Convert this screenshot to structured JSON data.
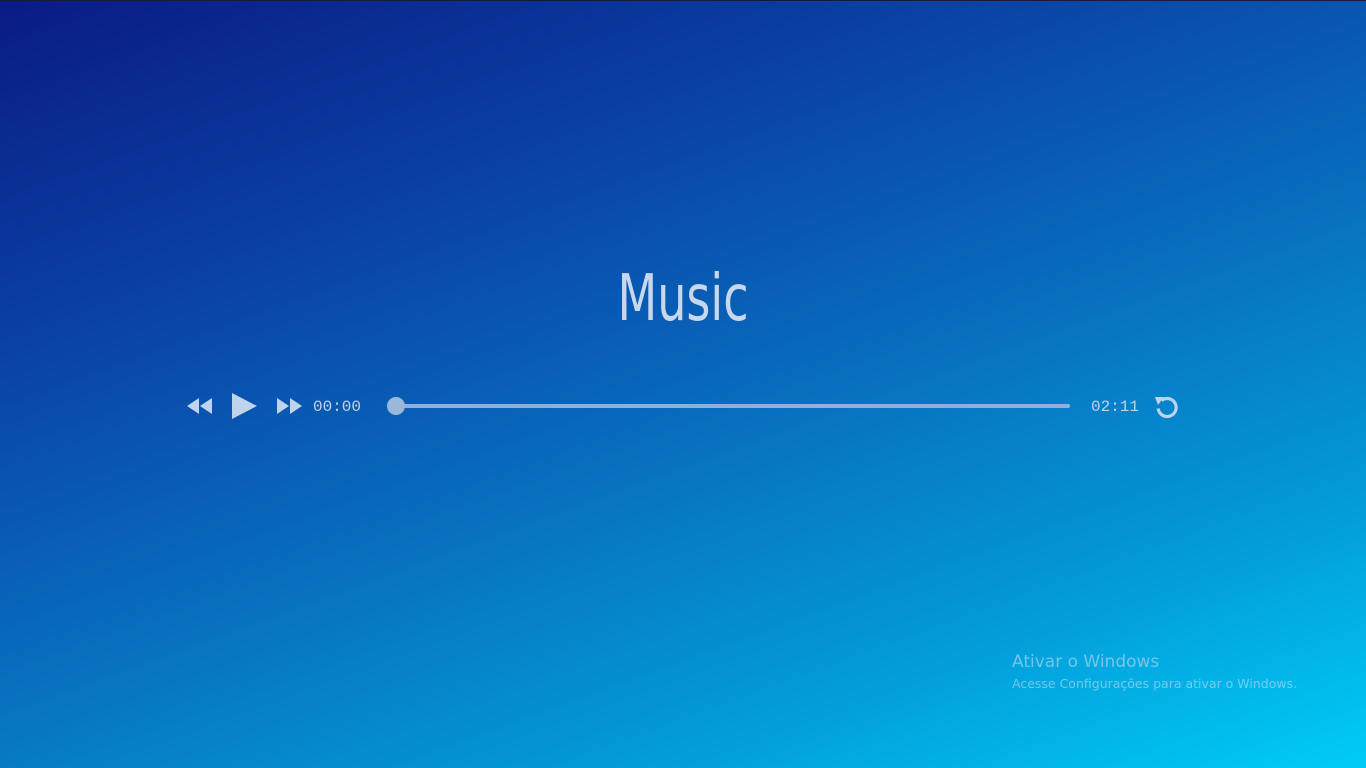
{
  "title": "Music",
  "player": {
    "current_time": "00:00",
    "duration": "02:11",
    "progress": 0,
    "icons": {
      "rewind": "rewind-icon",
      "play": "play-icon",
      "forward": "fast-forward-icon",
      "repeat": "repeat-icon"
    }
  },
  "watermark": {
    "title": "Ativar o Windows",
    "subtitle": "Acesse Configurações para ativar o Windows."
  },
  "colors": {
    "gradient_start": "#0a1a86",
    "gradient_end": "#00ccf8",
    "foreground": "#c6d7ee"
  }
}
